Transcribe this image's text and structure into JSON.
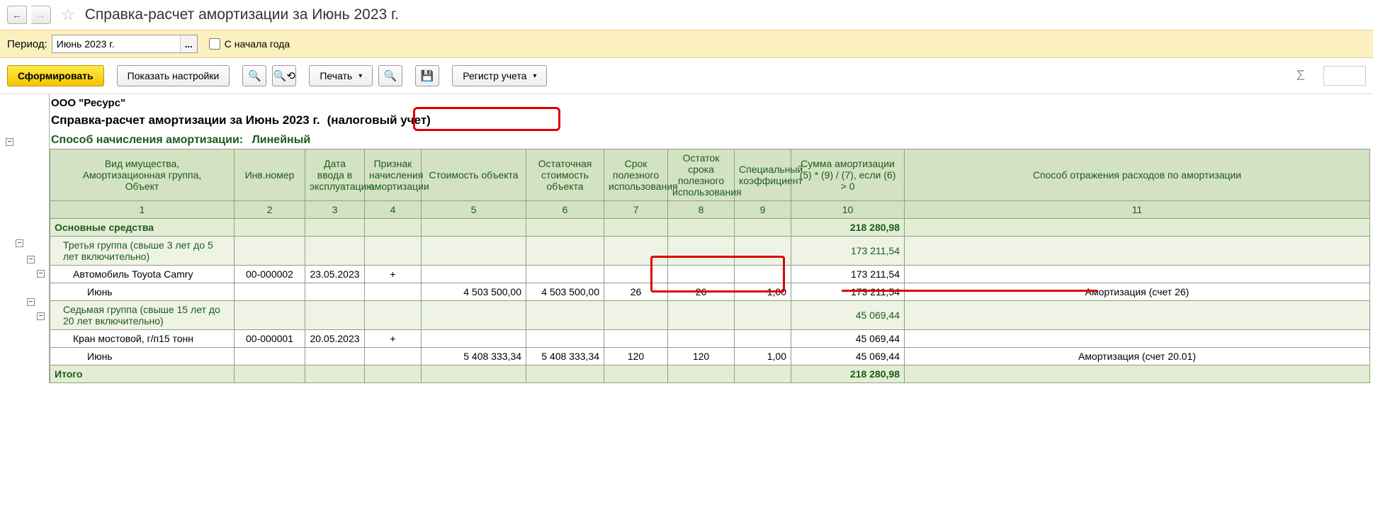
{
  "title": "Справка-расчет амортизации за Июнь 2023 г.",
  "filter": {
    "period_label": "Период:",
    "period_value": "Июнь 2023 г.",
    "from_start_label": "С начала года"
  },
  "toolbar": {
    "generate": "Сформировать",
    "show_settings": "Показать настройки",
    "print": "Печать",
    "register": "Регистр учета"
  },
  "org": "ООО \"Ресурс\"",
  "report_title_prefix": "Справка-расчет амортизации за Июнь 2023 г.",
  "report_title_suffix": "(налоговый учет)",
  "method_label": "Способ начисления амортизации:",
  "method_value": "Линейный",
  "columns": {
    "c1": "Вид имущества,\nАмортизационная группа,\nОбъект",
    "c2": "Инв.номер",
    "c3": "Дата ввода в эксплуатацию",
    "c4": "Признак начисления амортизации",
    "c5": "Стоимость объекта",
    "c6": "Остаточная стоимость объекта",
    "c7": "Срок полезного использования",
    "c8": "Остаток срока полезного использования",
    "c9": "Специальный коэффициент",
    "c10": "Сумма амортизации (5) * (9) / (7), если (6) > 0",
    "c11": "Способ отражения расходов по амортизации"
  },
  "colnums": {
    "n1": "1",
    "n2": "2",
    "n3": "3",
    "n4": "4",
    "n5": "5",
    "n6": "6",
    "n7": "7",
    "n8": "8",
    "n9": "9",
    "n10": "10",
    "n11": "11"
  },
  "g1": {
    "name": "Основные средства",
    "sum": "218 280,98"
  },
  "g2a": {
    "name": "Третья группа (свыше 3 лет до 5 лет включительно)",
    "sum": "173 211,54"
  },
  "r1": {
    "name": "Автомобиль Toyota Camry",
    "inv": "00-000002",
    "date": "23.05.2023",
    "flag": "+",
    "sum": "173 211,54"
  },
  "r1m": {
    "name": "Июнь",
    "cost": "4 503 500,00",
    "residual": "4 503 500,00",
    "term": "26",
    "remain": "26",
    "coef": "1,00",
    "sum": "173 211,54",
    "expense": "Амортизация (счет 26)"
  },
  "g2b": {
    "name": "Седьмая группа (свыше 15 лет до 20 лет включительно)",
    "sum": "45 069,44"
  },
  "r2": {
    "name": "Кран мостовой, г/п15 тонн",
    "inv": "00-000001",
    "date": "20.05.2023",
    "flag": "+",
    "sum": "45 069,44"
  },
  "r2m": {
    "name": "Июнь",
    "cost": "5 408 333,34",
    "residual": "5 408 333,34",
    "term": "120",
    "remain": "120",
    "coef": "1,00",
    "sum": "45 069,44",
    "expense": "Амортизация (счет 20.01)"
  },
  "total": {
    "label": "Итого",
    "sum": "218 280,98"
  }
}
